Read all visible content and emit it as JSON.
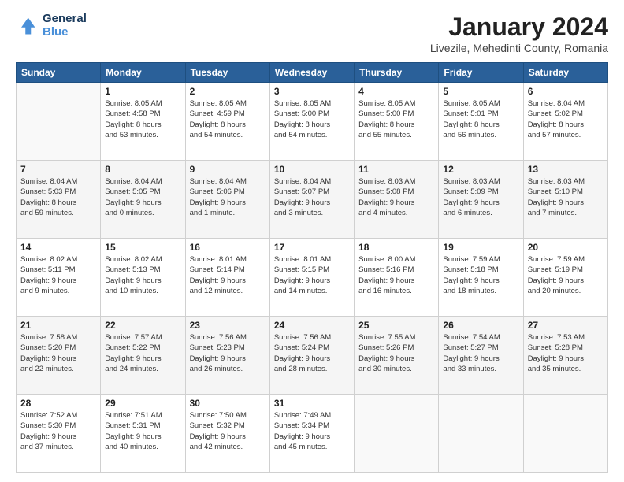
{
  "header": {
    "logo_general": "General",
    "logo_blue": "Blue",
    "month_title": "January 2024",
    "location": "Livezile, Mehedinti County, Romania"
  },
  "days_of_week": [
    "Sunday",
    "Monday",
    "Tuesday",
    "Wednesday",
    "Thursday",
    "Friday",
    "Saturday"
  ],
  "weeks": [
    [
      {
        "day": "",
        "info": ""
      },
      {
        "day": "1",
        "info": "Sunrise: 8:05 AM\nSunset: 4:58 PM\nDaylight: 8 hours\nand 53 minutes."
      },
      {
        "day": "2",
        "info": "Sunrise: 8:05 AM\nSunset: 4:59 PM\nDaylight: 8 hours\nand 54 minutes."
      },
      {
        "day": "3",
        "info": "Sunrise: 8:05 AM\nSunset: 5:00 PM\nDaylight: 8 hours\nand 54 minutes."
      },
      {
        "day": "4",
        "info": "Sunrise: 8:05 AM\nSunset: 5:00 PM\nDaylight: 8 hours\nand 55 minutes."
      },
      {
        "day": "5",
        "info": "Sunrise: 8:05 AM\nSunset: 5:01 PM\nDaylight: 8 hours\nand 56 minutes."
      },
      {
        "day": "6",
        "info": "Sunrise: 8:04 AM\nSunset: 5:02 PM\nDaylight: 8 hours\nand 57 minutes."
      }
    ],
    [
      {
        "day": "7",
        "info": "Sunrise: 8:04 AM\nSunset: 5:03 PM\nDaylight: 8 hours\nand 59 minutes."
      },
      {
        "day": "8",
        "info": "Sunrise: 8:04 AM\nSunset: 5:05 PM\nDaylight: 9 hours\nand 0 minutes."
      },
      {
        "day": "9",
        "info": "Sunrise: 8:04 AM\nSunset: 5:06 PM\nDaylight: 9 hours\nand 1 minute."
      },
      {
        "day": "10",
        "info": "Sunrise: 8:04 AM\nSunset: 5:07 PM\nDaylight: 9 hours\nand 3 minutes."
      },
      {
        "day": "11",
        "info": "Sunrise: 8:03 AM\nSunset: 5:08 PM\nDaylight: 9 hours\nand 4 minutes."
      },
      {
        "day": "12",
        "info": "Sunrise: 8:03 AM\nSunset: 5:09 PM\nDaylight: 9 hours\nand 6 minutes."
      },
      {
        "day": "13",
        "info": "Sunrise: 8:03 AM\nSunset: 5:10 PM\nDaylight: 9 hours\nand 7 minutes."
      }
    ],
    [
      {
        "day": "14",
        "info": "Sunrise: 8:02 AM\nSunset: 5:11 PM\nDaylight: 9 hours\nand 9 minutes."
      },
      {
        "day": "15",
        "info": "Sunrise: 8:02 AM\nSunset: 5:13 PM\nDaylight: 9 hours\nand 10 minutes."
      },
      {
        "day": "16",
        "info": "Sunrise: 8:01 AM\nSunset: 5:14 PM\nDaylight: 9 hours\nand 12 minutes."
      },
      {
        "day": "17",
        "info": "Sunrise: 8:01 AM\nSunset: 5:15 PM\nDaylight: 9 hours\nand 14 minutes."
      },
      {
        "day": "18",
        "info": "Sunrise: 8:00 AM\nSunset: 5:16 PM\nDaylight: 9 hours\nand 16 minutes."
      },
      {
        "day": "19",
        "info": "Sunrise: 7:59 AM\nSunset: 5:18 PM\nDaylight: 9 hours\nand 18 minutes."
      },
      {
        "day": "20",
        "info": "Sunrise: 7:59 AM\nSunset: 5:19 PM\nDaylight: 9 hours\nand 20 minutes."
      }
    ],
    [
      {
        "day": "21",
        "info": "Sunrise: 7:58 AM\nSunset: 5:20 PM\nDaylight: 9 hours\nand 22 minutes."
      },
      {
        "day": "22",
        "info": "Sunrise: 7:57 AM\nSunset: 5:22 PM\nDaylight: 9 hours\nand 24 minutes."
      },
      {
        "day": "23",
        "info": "Sunrise: 7:56 AM\nSunset: 5:23 PM\nDaylight: 9 hours\nand 26 minutes."
      },
      {
        "day": "24",
        "info": "Sunrise: 7:56 AM\nSunset: 5:24 PM\nDaylight: 9 hours\nand 28 minutes."
      },
      {
        "day": "25",
        "info": "Sunrise: 7:55 AM\nSunset: 5:26 PM\nDaylight: 9 hours\nand 30 minutes."
      },
      {
        "day": "26",
        "info": "Sunrise: 7:54 AM\nSunset: 5:27 PM\nDaylight: 9 hours\nand 33 minutes."
      },
      {
        "day": "27",
        "info": "Sunrise: 7:53 AM\nSunset: 5:28 PM\nDaylight: 9 hours\nand 35 minutes."
      }
    ],
    [
      {
        "day": "28",
        "info": "Sunrise: 7:52 AM\nSunset: 5:30 PM\nDaylight: 9 hours\nand 37 minutes."
      },
      {
        "day": "29",
        "info": "Sunrise: 7:51 AM\nSunset: 5:31 PM\nDaylight: 9 hours\nand 40 minutes."
      },
      {
        "day": "30",
        "info": "Sunrise: 7:50 AM\nSunset: 5:32 PM\nDaylight: 9 hours\nand 42 minutes."
      },
      {
        "day": "31",
        "info": "Sunrise: 7:49 AM\nSunset: 5:34 PM\nDaylight: 9 hours\nand 45 minutes."
      },
      {
        "day": "",
        "info": ""
      },
      {
        "day": "",
        "info": ""
      },
      {
        "day": "",
        "info": ""
      }
    ]
  ]
}
